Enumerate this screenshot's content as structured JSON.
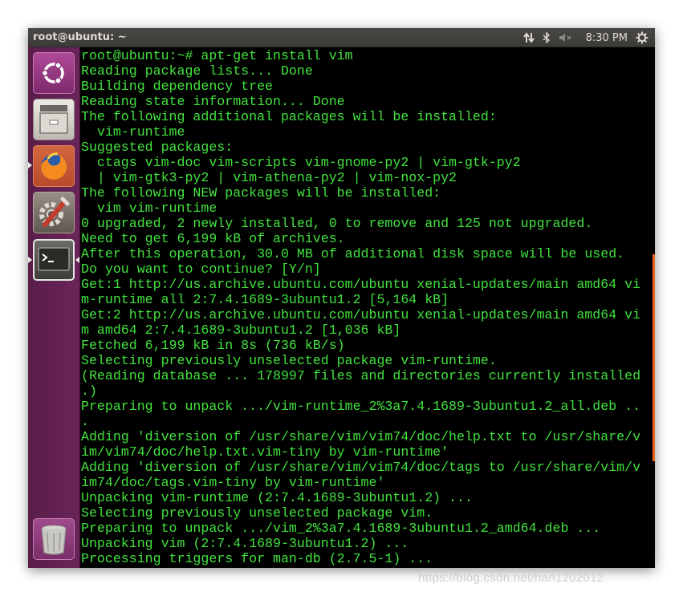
{
  "window": {
    "title": "root@ubuntu: ~"
  },
  "tray": {
    "clock": "8:30 PM",
    "icons": [
      "network-transfer-icon",
      "bluetooth-icon",
      "volume-muted-icon",
      "gear-icon"
    ]
  },
  "launcher": {
    "items": [
      {
        "name": "ubuntu-dash-icon",
        "running": false
      },
      {
        "name": "files-icon",
        "running": false
      },
      {
        "name": "firefox-icon",
        "running": true
      },
      {
        "name": "system-settings-icon",
        "running": false
      },
      {
        "name": "terminal-icon",
        "running": true,
        "active": true
      },
      {
        "name": "trash-icon",
        "running": false
      }
    ]
  },
  "terminal": {
    "text_color": "#41e23d",
    "background": "#000000",
    "lines": [
      "root@ubuntu:~# apt-get install vim",
      "Reading package lists... Done",
      "Building dependency tree",
      "Reading state information... Done",
      "The following additional packages will be installed:",
      "  vim-runtime",
      "Suggested packages:",
      "  ctags vim-doc vim-scripts vim-gnome-py2 | vim-gtk-py2",
      "  | vim-gtk3-py2 | vim-athena-py2 | vim-nox-py2",
      "The following NEW packages will be installed:",
      "  vim vim-runtime",
      "0 upgraded, 2 newly installed, 0 to remove and 125 not upgraded.",
      "Need to get 6,199 kB of archives.",
      "After this operation, 30.0 MB of additional disk space will be used.",
      "Do you want to continue? [Y/n]",
      "Get:1 http://us.archive.ubuntu.com/ubuntu xenial-updates/main amd64 vi",
      "m-runtime all 2:7.4.1689-3ubuntu1.2 [5,164 kB]",
      "Get:2 http://us.archive.ubuntu.com/ubuntu xenial-updates/main amd64 vi",
      "m amd64 2:7.4.1689-3ubuntu1.2 [1,036 kB]",
      "Fetched 6,199 kB in 8s (736 kB/s)",
      "Selecting previously unselected package vim-runtime.",
      "(Reading database ... 178997 files and directories currently installed",
      ".)",
      "Preparing to unpack .../vim-runtime_2%3a7.4.1689-3ubuntu1.2_all.deb ..",
      ".",
      "Adding 'diversion of /usr/share/vim/vim74/doc/help.txt to /usr/share/v",
      "im/vim74/doc/help.txt.vim-tiny by vim-runtime'",
      "Adding 'diversion of /usr/share/vim/vim74/doc/tags to /usr/share/vim/v",
      "im74/doc/tags.vim-tiny by vim-runtime'",
      "Unpacking vim-runtime (2:7.4.1689-3ubuntu1.2) ...",
      "Selecting previously unselected package vim.",
      "Preparing to unpack .../vim_2%3a7.4.1689-3ubuntu1.2_amd64.deb ...",
      "Unpacking vim (2:7.4.1689-3ubuntu1.2) ...",
      "Processing triggers for man-db (2.7.5-1) ..."
    ]
  },
  "watermark": "https://blog.csdn.net/han1202012",
  "colors": {
    "launcher": "#5f1f4f",
    "topbar": "#3c3b37",
    "scrollbar": "#e4691d"
  }
}
